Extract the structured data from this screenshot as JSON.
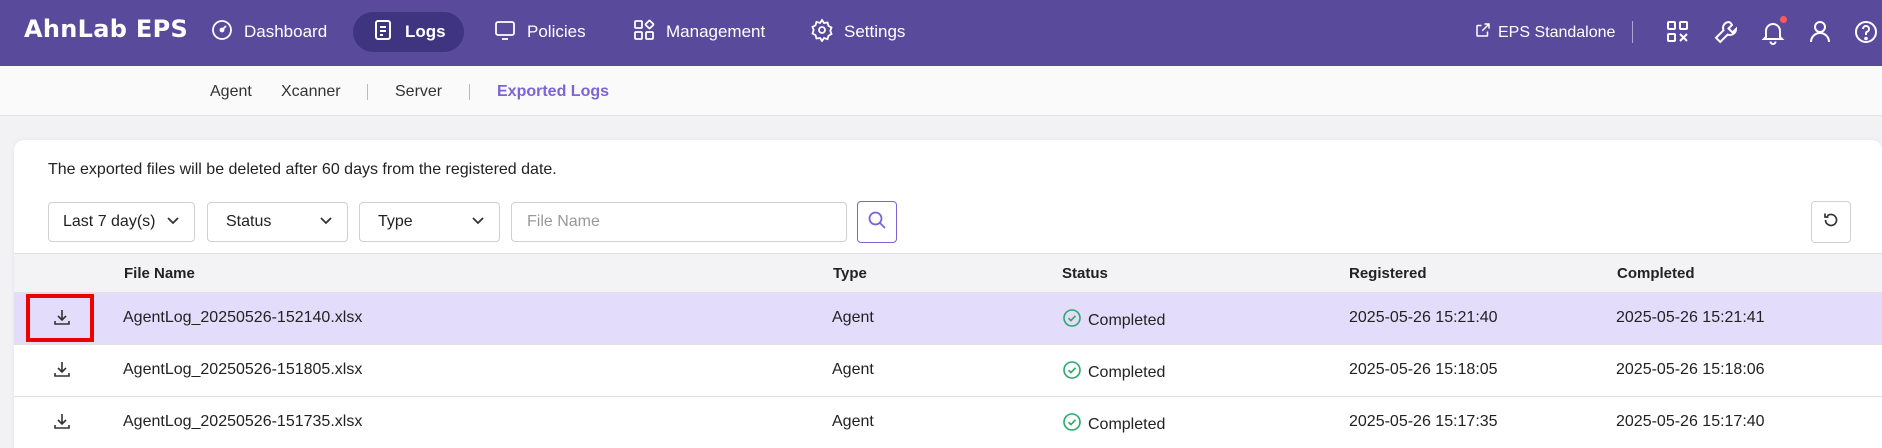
{
  "app": {
    "logo": "AhnLab EPS"
  },
  "topnav": {
    "items": [
      {
        "label": "Dashboard",
        "icon": "gauge-icon"
      },
      {
        "label": "Logs",
        "icon": "document-icon",
        "active": true
      },
      {
        "label": "Policies",
        "icon": "monitor-icon"
      },
      {
        "label": "Management",
        "icon": "grid-icon"
      },
      {
        "label": "Settings",
        "icon": "gear-icon"
      }
    ],
    "eps_link": "EPS Standalone",
    "right_icons": [
      "apps-icon",
      "wrench-icon",
      "bell-icon",
      "user-icon",
      "help-icon"
    ],
    "brand_color": "#5a4a9c"
  },
  "subnav": {
    "items": [
      "Agent",
      "Xcanner",
      "Server",
      "Exported Logs"
    ],
    "active": "Exported Logs",
    "accent_color": "#7c63d6"
  },
  "main": {
    "notice": "The exported files will be deleted after 60 days from the registered date.",
    "filters": {
      "period": "Last 7 day(s)",
      "status": "Status",
      "type": "Type",
      "file_name_placeholder": "File Name"
    },
    "table": {
      "columns": [
        "File Name",
        "Type",
        "Status",
        "Registered",
        "Completed"
      ],
      "rows": [
        {
          "file": "AgentLog_20250526-152140.xlsx",
          "type": "Agent",
          "status": "Completed",
          "registered": "2025-05-26 15:21:40",
          "completed": "2025-05-26 15:21:41",
          "selected": true
        },
        {
          "file": "AgentLog_20250526-151805.xlsx",
          "type": "Agent",
          "status": "Completed",
          "registered": "2025-05-26 15:18:05",
          "completed": "2025-05-26 15:18:06"
        },
        {
          "file": "AgentLog_20250526-151735.xlsx",
          "type": "Agent",
          "status": "Completed",
          "registered": "2025-05-26 15:17:35",
          "completed": "2025-05-26 15:17:40"
        }
      ]
    }
  }
}
